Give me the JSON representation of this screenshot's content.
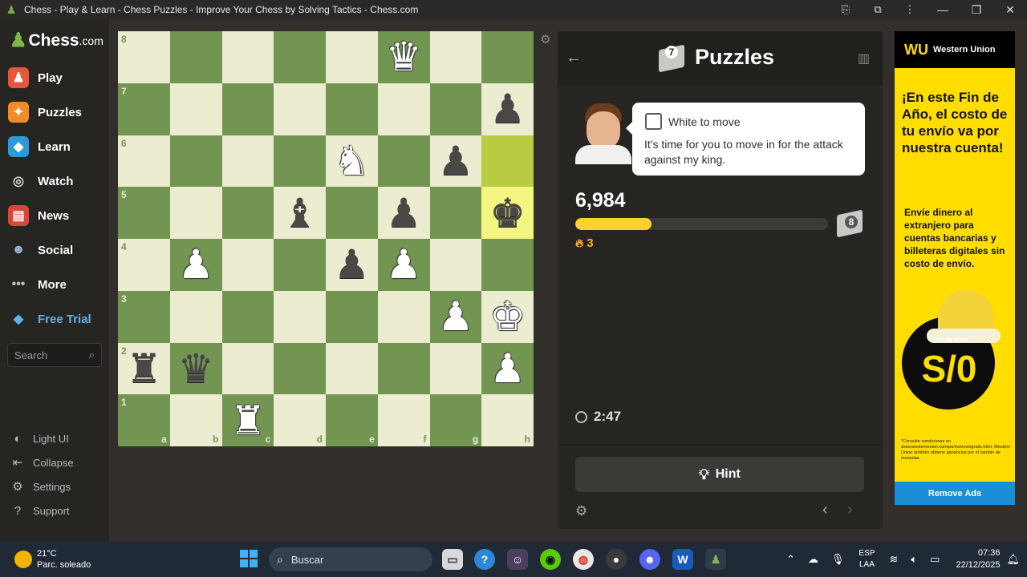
{
  "window": {
    "title": "Chess - Play & Learn - Chess Puzzles - Improve Your Chess by Solving Tactics - Chess.com"
  },
  "sidebar": {
    "logo": {
      "main": "Chess",
      "suffix": ".com"
    },
    "items": [
      {
        "label": "Play",
        "icon": "pawn-play-icon",
        "color": "#e8553f"
      },
      {
        "label": "Puzzles",
        "icon": "puzzle-icon",
        "color": "#f28c28"
      },
      {
        "label": "Learn",
        "icon": "learn-cube-icon",
        "color": "#2e9ad8"
      },
      {
        "label": "Watch",
        "icon": "binoculars-icon",
        "color": "#b0b0b0"
      },
      {
        "label": "News",
        "icon": "newspaper-icon",
        "color": "#d9453a"
      },
      {
        "label": "Social",
        "icon": "people-icon",
        "color": "#7c9ec7"
      },
      {
        "label": "More",
        "icon": "dots-icon",
        "color": "#bcbbb9"
      },
      {
        "label": "Free Trial",
        "icon": "diamond-icon",
        "color": "#5ab4f5"
      }
    ],
    "search_placeholder": "Search",
    "bottom": [
      {
        "label": "Light UI",
        "icon": "contrast-icon"
      },
      {
        "label": "Collapse",
        "icon": "collapse-icon"
      },
      {
        "label": "Settings",
        "icon": "gear-icon"
      },
      {
        "label": "Support",
        "icon": "help-icon"
      }
    ]
  },
  "board": {
    "files": [
      "a",
      "b",
      "c",
      "d",
      "e",
      "f",
      "g",
      "h"
    ],
    "ranks": [
      "8",
      "7",
      "6",
      "5",
      "4",
      "3",
      "2",
      "1"
    ],
    "pieces": [
      {
        "square": "f8",
        "type": "queen",
        "color": "white"
      },
      {
        "square": "h7",
        "type": "pawn",
        "color": "black"
      },
      {
        "square": "e6",
        "type": "knight",
        "color": "white"
      },
      {
        "square": "g6",
        "type": "pawn",
        "color": "black"
      },
      {
        "square": "d5",
        "type": "bishop",
        "color": "black"
      },
      {
        "square": "f5",
        "type": "pawn",
        "color": "black"
      },
      {
        "square": "h5",
        "type": "king",
        "color": "black"
      },
      {
        "square": "b4",
        "type": "pawn",
        "color": "white"
      },
      {
        "square": "e4",
        "type": "pawn",
        "color": "black"
      },
      {
        "square": "f4",
        "type": "pawn",
        "color": "white"
      },
      {
        "square": "g3",
        "type": "pawn",
        "color": "white"
      },
      {
        "square": "h3",
        "type": "king",
        "color": "white"
      },
      {
        "square": "a2",
        "type": "rook",
        "color": "black"
      },
      {
        "square": "b2",
        "type": "queen",
        "color": "black"
      },
      {
        "square": "h2",
        "type": "pawn",
        "color": "white"
      },
      {
        "square": "c1",
        "type": "rook",
        "color": "white"
      }
    ],
    "highlighted": [
      "h6",
      "h5"
    ]
  },
  "panel": {
    "title": "Puzzles",
    "badge_level": "7",
    "to_move": "White to move",
    "coach_message": "It's time for you to move in for the attack against my king.",
    "rating": "6,984",
    "rating_progress": 0.3,
    "next_badge_level": "8",
    "streak": "3",
    "timer": "2:47",
    "hint_label": "Hint"
  },
  "ad": {
    "brand": "Western Union",
    "headline": "¡En este Fin de Año, el costo de tu envío va por nuestra cuenta!",
    "sub": "Envíe dinero al extranjero para cuentas bancarias y billeteras digitales sin costo de envío.",
    "cost_label": "Costo de envío",
    "price": "S/0",
    "fine_print": "*Consulte condiciones en www.westernunion.com/pe/es/enviogratis.html. Western Union también obtiene ganancias por el cambio de monedas.",
    "remove_label": "Remove Ads"
  },
  "taskbar": {
    "weather_temp": "21°C",
    "weather_desc": "Parc. soleado",
    "search_label": "Buscar",
    "lang_top": "ESP",
    "lang_bottom": "LAA",
    "time": "07:36",
    "date": "22/12/2025",
    "discord_badge": "9+"
  }
}
